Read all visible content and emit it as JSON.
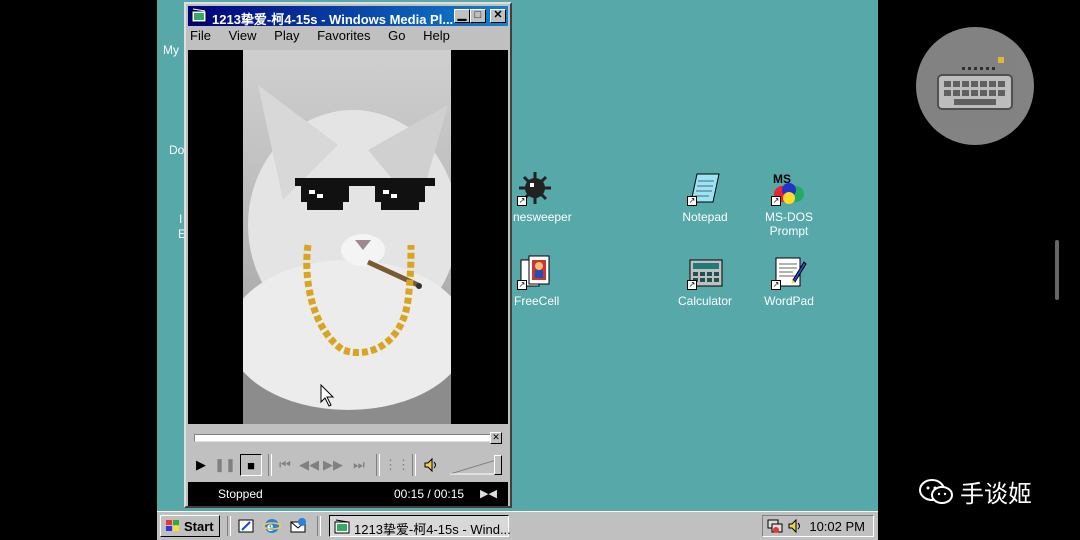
{
  "desktop": {
    "left_edge_labels": [
      "My",
      "Do",
      "I",
      "E"
    ],
    "icons": [
      {
        "id": "minesweeper",
        "label": "nesweeper",
        "icon": "minesweeper-icon"
      },
      {
        "id": "freecell",
        "label": "FreeCell",
        "icon": "freecell-icon"
      },
      {
        "id": "notepad",
        "label": "Notepad",
        "icon": "notepad-icon"
      },
      {
        "id": "calculator",
        "label": "Calculator",
        "icon": "calculator-icon"
      },
      {
        "id": "msdos",
        "label": "MS-DOS\nPrompt",
        "icon": "msdos-icon"
      },
      {
        "id": "wordpad",
        "label": "WordPad",
        "icon": "wordpad-icon"
      }
    ],
    "color": "#57a8a8"
  },
  "window": {
    "title": "1213挚爱-柯4-15s - Windows Media Pl...",
    "menu": [
      "File",
      "View",
      "Play",
      "Favorites",
      "Go",
      "Help"
    ],
    "status": "Stopped",
    "time": "00:15 / 00:15",
    "title_color": "#00007a"
  },
  "taskbar": {
    "start_label": "Start",
    "task_label": "1213挚爱-柯4-15s - Wind...",
    "clock": "10:02 PM"
  },
  "watermark": "手谈姬"
}
